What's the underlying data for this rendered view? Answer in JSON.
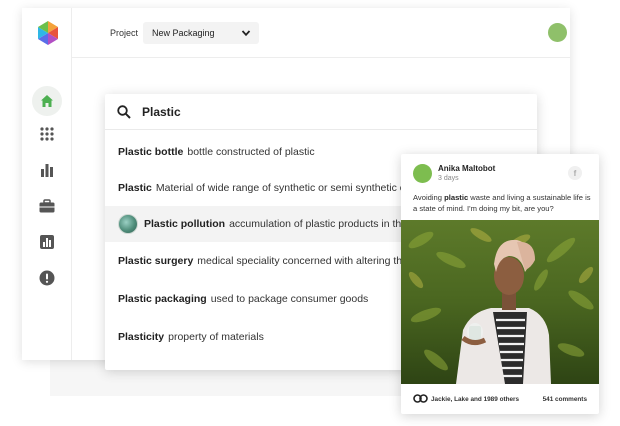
{
  "topbar": {
    "project_label": "Project",
    "project_value": "New Packaging"
  },
  "sidebar": {
    "items": [
      {
        "icon": "home-icon",
        "active": true
      },
      {
        "icon": "grid-icon",
        "active": false
      },
      {
        "icon": "bar-chart-icon",
        "active": false
      },
      {
        "icon": "briefcase-icon",
        "active": false
      },
      {
        "icon": "chart-box-icon",
        "active": false
      },
      {
        "icon": "alert-icon",
        "active": false
      }
    ]
  },
  "search": {
    "query": "Plastic",
    "results": [
      {
        "term": "Plastic bottle",
        "description": "bottle constructed of plastic",
        "has_thumbnail": false,
        "highlighted": false
      },
      {
        "term": "Plastic",
        "description": "Material of wide range of synthetic or semi synthetic organic compounds",
        "has_thumbnail": false,
        "highlighted": false
      },
      {
        "term": "Plastic pollution",
        "description": "accumulation of plastic products in the environment",
        "has_thumbnail": true,
        "highlighted": true
      },
      {
        "term": "Plastic surgery",
        "description": "medical speciality concerned with altering the human body",
        "has_thumbnail": false,
        "highlighted": false
      },
      {
        "term": "Plastic packaging",
        "description": "used to package consumer goods",
        "has_thumbnail": false,
        "highlighted": false
      },
      {
        "term": "Plasticity",
        "description": "property of materials",
        "has_thumbnail": false,
        "highlighted": false
      }
    ]
  },
  "post": {
    "author": "Anika Maltobot",
    "time": "3 days",
    "network_icon": "f",
    "text_before": "Avoiding ",
    "text_bold": "plastic",
    "text_after": " waste and living a sustainable life is a state of mind. I'm doing my bit, are you?",
    "likes": "Jackie, Lake and 1989 others",
    "comments": "541 comments"
  },
  "colors": {
    "accent_green": "#4caf50",
    "avatar_green": "#8fc06a",
    "icon_gray": "#555555"
  }
}
